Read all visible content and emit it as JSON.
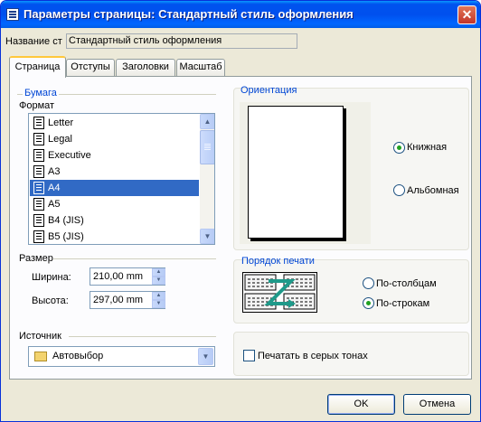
{
  "window": {
    "title": "Параметры страницы: Стандартный стиль оформления"
  },
  "name_row": {
    "label": "Название ст",
    "value": "Стандартный стиль оформления"
  },
  "tabs": [
    {
      "label": "Страница",
      "active": true
    },
    {
      "label": "Отступы",
      "active": false
    },
    {
      "label": "Заголовки",
      "active": false
    },
    {
      "label": "Масштаб",
      "active": false
    }
  ],
  "paper": {
    "group_label": "Бумага",
    "format_label": "Формат",
    "formats": [
      "Letter",
      "Legal",
      "Executive",
      "A3",
      "A4",
      "A5",
      "B4 (JIS)",
      "B5 (JIS)"
    ],
    "selected_format": "A4"
  },
  "size": {
    "group_label": "Размер",
    "width_label": "Ширина:",
    "width_value": "210,00 mm",
    "height_label": "Высота:",
    "height_value": "297,00 mm"
  },
  "source": {
    "group_label": "Источник",
    "value": "Автовыбор"
  },
  "orientation": {
    "group_label": "Ориентация",
    "portrait_label": "Книжная",
    "landscape_label": "Альбомная",
    "selected": "portrait"
  },
  "print_order": {
    "group_label": "Порядок печати",
    "by_columns_label": "По-столбцам",
    "by_rows_label": "По-строкам",
    "selected": "rows"
  },
  "grayscale": {
    "label": "Печатать в серых тонах",
    "checked": false
  },
  "buttons": {
    "ok": "OK",
    "cancel": "Отмена"
  },
  "colors": {
    "title_bar": "#0054e3",
    "selection": "#316ac5",
    "group_label": "#0046d5",
    "dialog_bg": "#ece9d8"
  }
}
